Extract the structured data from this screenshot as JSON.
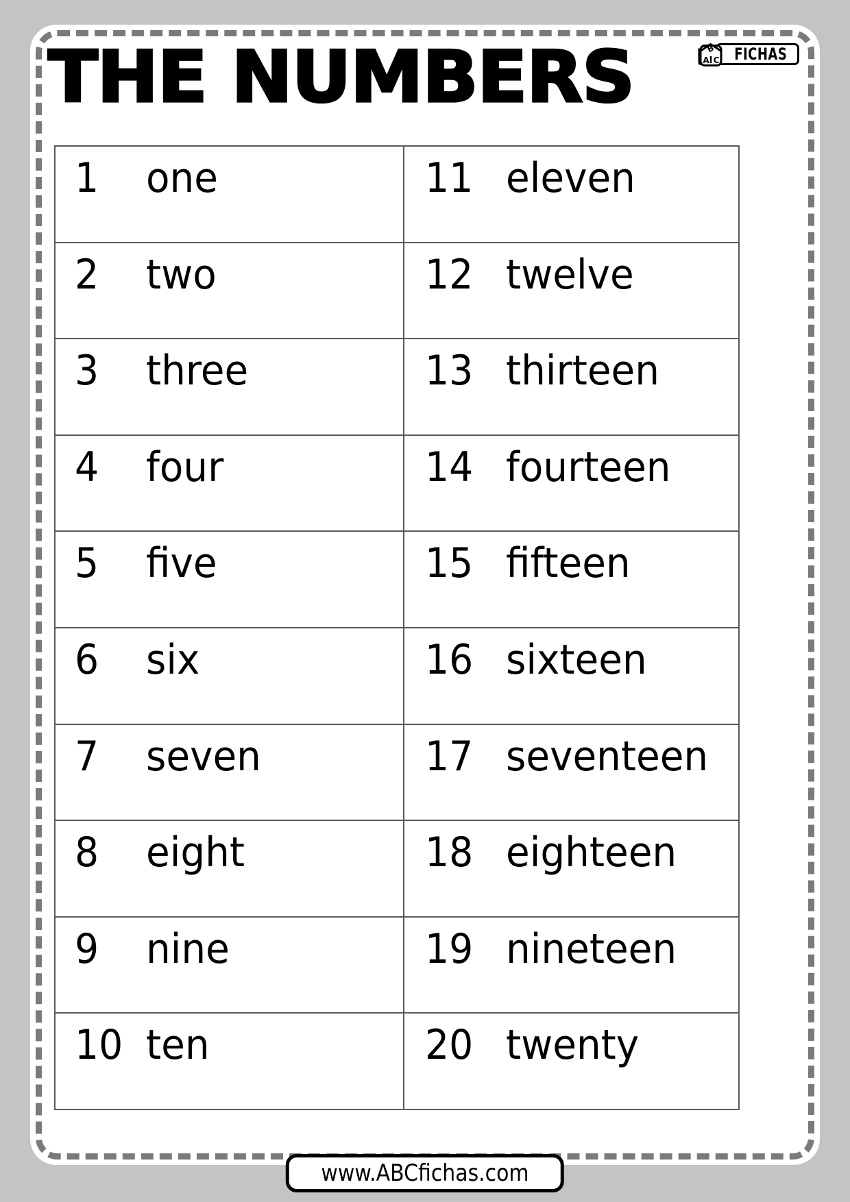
{
  "page": {
    "title": "THE NUMBERS",
    "background_color": "#c4c4c4",
    "sheet_color": "#ffffff",
    "border_color": "#7a7a7a",
    "table_line_color": "#5a5a5a",
    "text_color": "#000000"
  },
  "brand": {
    "cube_letters": [
      "A",
      "B",
      "C"
    ],
    "name": "FICHAS",
    "cube_icon": "abc-cube-icon"
  },
  "table": {
    "rows": [
      {
        "left": {
          "number": "1",
          "word": "one"
        },
        "right": {
          "number": "11",
          "word": "eleven"
        }
      },
      {
        "left": {
          "number": "2",
          "word": "two"
        },
        "right": {
          "number": "12",
          "word": "twelve"
        }
      },
      {
        "left": {
          "number": "3",
          "word": "three"
        },
        "right": {
          "number": "13",
          "word": "thirteen"
        }
      },
      {
        "left": {
          "number": "4",
          "word": "four"
        },
        "right": {
          "number": "14",
          "word": "fourteen"
        }
      },
      {
        "left": {
          "number": "5",
          "word": "five"
        },
        "right": {
          "number": "15",
          "word": "fifteen"
        }
      },
      {
        "left": {
          "number": "6",
          "word": "six"
        },
        "right": {
          "number": "16",
          "word": "sixteen"
        }
      },
      {
        "left": {
          "number": "7",
          "word": "seven"
        },
        "right": {
          "number": "17",
          "word": "seventeen"
        }
      },
      {
        "left": {
          "number": "8",
          "word": "eight"
        },
        "right": {
          "number": "18",
          "word": "eighteen"
        }
      },
      {
        "left": {
          "number": "9",
          "word": "nine"
        },
        "right": {
          "number": "19",
          "word": "nineteen"
        }
      },
      {
        "left": {
          "number": "10",
          "word": "ten"
        },
        "right": {
          "number": "20",
          "word": "twenty"
        }
      }
    ]
  },
  "footer": {
    "url": "www.ABCfichas.com"
  }
}
